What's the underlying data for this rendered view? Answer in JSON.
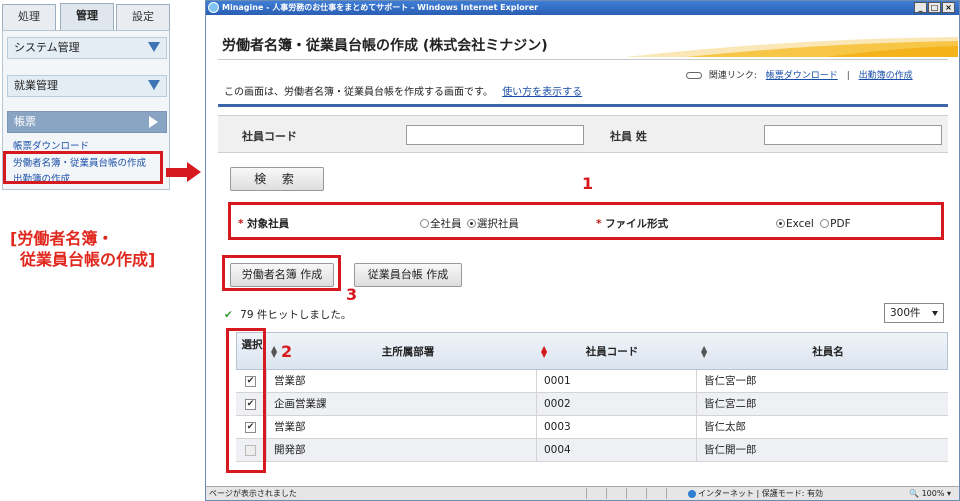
{
  "nav": {
    "tabs": [
      "処理",
      "管理",
      "設定"
    ],
    "sections": [
      "システム管理",
      "就業管理",
      "帳票"
    ],
    "links": [
      "帳票ダウンロード",
      "労働者名簿・従業員台帳の作成",
      "出勤簿の作成"
    ]
  },
  "caption": [
    "[労働者名簿・",
    "従業員台帳の作成]"
  ],
  "window": {
    "title": "Minagine - 人事労務のお仕事をまとめてサポート - Windows Internet Explorer",
    "buttons": [
      "_",
      "□",
      "×"
    ]
  },
  "page": {
    "title": "労働者名簿・従業員台帳の作成 (株式会社ミナジン)",
    "related_label": "関連リンク:",
    "related_links": [
      "帳票ダウンロード",
      "出勤簿の作成"
    ],
    "related_sep": "|",
    "description": "この画面は、労働者名簿・従業員台帳を作成する画面です。",
    "description_link": "使い方を表示する"
  },
  "search": {
    "employee_code_label": "社員コード",
    "employee_code_value": "",
    "last_name_label": "社員 姓",
    "last_name_value": "",
    "button": "検 索"
  },
  "options": {
    "target_label": "対象社員",
    "target_choices": [
      "全社員",
      "選択社員"
    ],
    "target_selected": "選択社員",
    "format_label": "ファイル形式",
    "format_choices": [
      "Excel",
      "PDF"
    ],
    "format_selected": "Excel",
    "required_mark": "*"
  },
  "actions": {
    "create_roster": "労働者名簿 作成",
    "create_ledger": "従業員台帳 作成"
  },
  "annotations": [
    "1",
    "2",
    "3"
  ],
  "results": {
    "hits_text": "79 件ヒットしました。",
    "per_page": "300件"
  },
  "table": {
    "headers": [
      "選択",
      "主所属部署",
      "社員コード",
      "社員名"
    ],
    "rows": [
      {
        "checked": true,
        "dept": "営業部",
        "code": "0001",
        "name": "皆仁宮一郎"
      },
      {
        "checked": true,
        "dept": "企画営業課",
        "code": "0002",
        "name": "皆仁宮二郎"
      },
      {
        "checked": true,
        "dept": "営業部",
        "code": "0003",
        "name": "皆仁太郎"
      },
      {
        "checked": false,
        "dept": "開発部",
        "code": "0004",
        "name": "皆仁開一郎"
      }
    ]
  },
  "status": {
    "left": "ページが表示されました",
    "zone": "インターネット | 保護モード: 有効",
    "zoom": "100%"
  },
  "colors": {
    "annotation_red": "#d6191f",
    "header_blue": "#3d66aa",
    "link_blue": "#1a4fa8"
  }
}
